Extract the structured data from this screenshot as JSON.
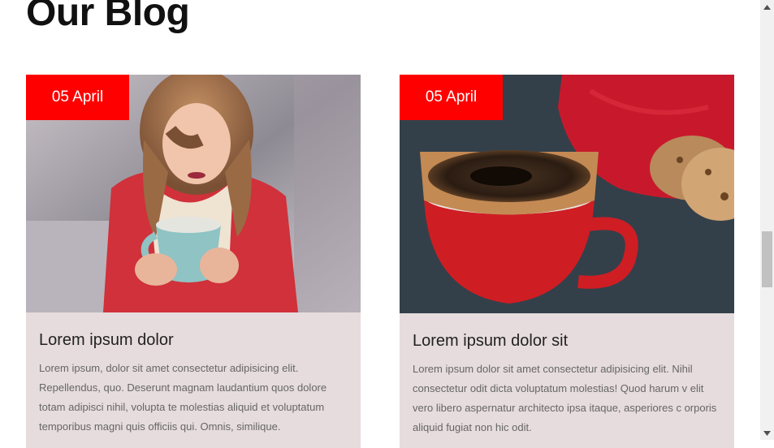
{
  "page": {
    "title": "Our Blog"
  },
  "posts": [
    {
      "date": "05 April",
      "title": "Lorem ipsum dolor",
      "excerpt": "Lorem ipsum, dolor sit amet consectetur adipisicing elit. Repellendus, quo. Deserunt magnam laudantium quos dolore totam adipisci nihil, volupta te molestias aliquid et voluptatum temporibus magni quis officiis qui. Omnis, similique."
    },
    {
      "date": "05 April",
      "title": "Lorem ipsum dolor sit",
      "excerpt": "Lorem ipsum dolor sit amet consectetur adipisicing elit. Nihil consectetur odit dicta voluptatum molestias! Quod harum v elit vero libero aspernatur architecto ipsa itaque, asperiores c orporis aliquid fugiat non hic odit."
    }
  ],
  "colors": {
    "accent": "#ff0000",
    "card_bg": "#e6dcdd",
    "heading": "#111111",
    "body_text": "#666666"
  },
  "icons": {
    "scroll_up": "triangle-up-icon",
    "scroll_down": "triangle-down-icon"
  }
}
